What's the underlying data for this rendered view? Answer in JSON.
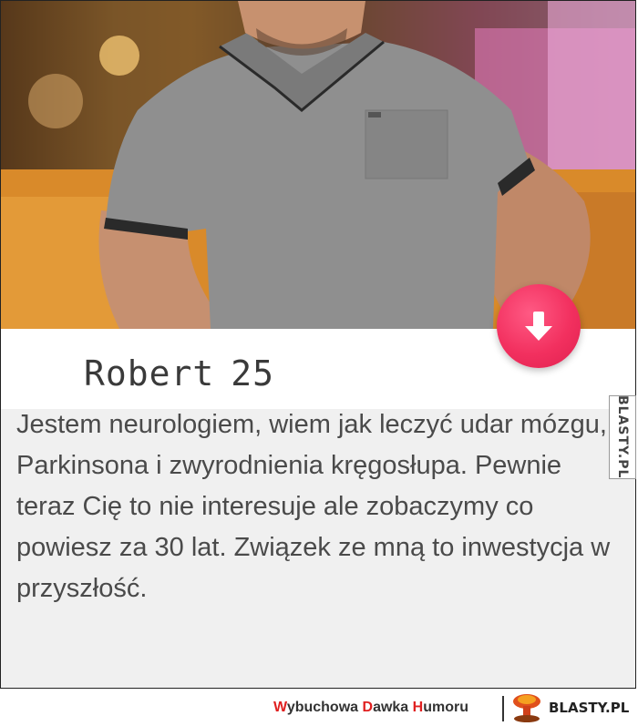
{
  "profile": {
    "name": "Robert",
    "age": "25",
    "bio": "Jestem neurologiem, wiem jak leczyć udar mózgu, Parkinsona i zwyrodnienia kręgosłupa. Pewnie teraz Cię to nie interesuje ale zobaczymy co powiesz za 30 lat. Związek ze mną to inwestycja w przyszłość."
  },
  "dislike_button": {
    "icon": "arrow-down-icon",
    "color": "#f2305f"
  },
  "watermark": "BLASTY.PL",
  "footer": {
    "tagline": {
      "w1_initial": "W",
      "w1_rest": "ybuchowa ",
      "w2_initial": "D",
      "w2_rest": "awka ",
      "w3_initial": "H",
      "w3_rest": "umoru"
    },
    "brand": "BLASTY.PL",
    "logo_icon": "mushroom-cloud-icon"
  }
}
